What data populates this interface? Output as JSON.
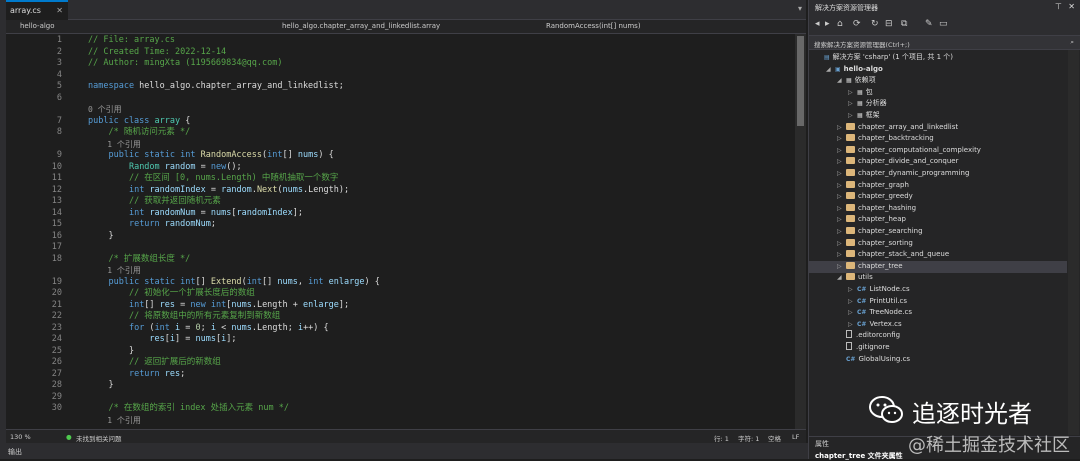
{
  "tabs": [
    {
      "label": "array.cs"
    }
  ],
  "nav": {
    "project": "hello-algo",
    "namespace": "hello_algo.chapter_array_and_linkedlist.array",
    "member": "RandomAccess(int[] nums)"
  },
  "code_lines": [
    {
      "n": "1",
      "parts": [
        [
          "c-com",
          "// File: array.cs"
        ]
      ]
    },
    {
      "n": "2",
      "parts": [
        [
          "c-com",
          "// Created Time: 2022-12-14"
        ]
      ]
    },
    {
      "n": "3",
      "parts": [
        [
          "c-com",
          "// Author: mingXta (1195669834@qq.com)"
        ]
      ]
    },
    {
      "n": "4",
      "parts": []
    },
    {
      "n": "5",
      "parts": [
        [
          "c-kw",
          "namespace"
        ],
        [
          "",
          " hello_algo.chapter_array_and_linkedlist;"
        ]
      ]
    },
    {
      "n": "6",
      "parts": []
    },
    {
      "lens": "0 个引用"
    },
    {
      "n": "7",
      "parts": [
        [
          "c-kw",
          "public class"
        ],
        [
          "",
          " "
        ],
        [
          "c-ty",
          "array"
        ],
        [
          "",
          " {"
        ]
      ]
    },
    {
      "n": "8",
      "parts": [
        [
          "",
          "    "
        ],
        [
          "c-com",
          "/* 随机访问元素 */"
        ]
      ]
    },
    {
      "lens": "    1 个引用"
    },
    {
      "n": "9",
      "parts": [
        [
          "",
          "    "
        ],
        [
          "c-kw",
          "public static int"
        ],
        [
          "",
          " "
        ],
        [
          "c-fn",
          "RandomAccess"
        ],
        [
          "",
          "("
        ],
        [
          "c-kw",
          "int"
        ],
        [
          "",
          "[] "
        ],
        [
          "c-var",
          "nums"
        ],
        [
          "",
          ") {"
        ]
      ]
    },
    {
      "n": "10",
      "parts": [
        [
          "",
          "        "
        ],
        [
          "c-ty",
          "Random"
        ],
        [
          "",
          " "
        ],
        [
          "c-var",
          "random"
        ],
        [
          "",
          " = "
        ],
        [
          "c-kw",
          "new"
        ],
        [
          "",
          "();"
        ]
      ]
    },
    {
      "n": "11",
      "parts": [
        [
          "",
          "        "
        ],
        [
          "c-com",
          "// 在区间 [0, nums.Length) 中随机抽取一个数字"
        ]
      ]
    },
    {
      "n": "12",
      "parts": [
        [
          "",
          "        "
        ],
        [
          "c-kw",
          "int"
        ],
        [
          "",
          " "
        ],
        [
          "c-var",
          "randomIndex"
        ],
        [
          "",
          " = "
        ],
        [
          "c-var",
          "random"
        ],
        [
          "",
          "."
        ],
        [
          "c-fn",
          "Next"
        ],
        [
          "",
          "("
        ],
        [
          "c-var",
          "nums"
        ],
        [
          "",
          ".Length);"
        ]
      ]
    },
    {
      "n": "13",
      "parts": [
        [
          "",
          "        "
        ],
        [
          "c-com",
          "// 获取并返回随机元素"
        ]
      ]
    },
    {
      "n": "14",
      "parts": [
        [
          "",
          "        "
        ],
        [
          "c-kw",
          "int"
        ],
        [
          "",
          " "
        ],
        [
          "c-var",
          "randomNum"
        ],
        [
          "",
          " = "
        ],
        [
          "c-var",
          "nums"
        ],
        [
          "",
          "["
        ],
        [
          "c-var",
          "randomIndex"
        ],
        [
          "",
          "];"
        ]
      ]
    },
    {
      "n": "15",
      "parts": [
        [
          "",
          "        "
        ],
        [
          "c-kw",
          "return"
        ],
        [
          "",
          " "
        ],
        [
          "c-var",
          "randomNum"
        ],
        [
          "",
          ";"
        ]
      ]
    },
    {
      "n": "16",
      "parts": [
        [
          "",
          "    }"
        ]
      ]
    },
    {
      "n": "17",
      "parts": []
    },
    {
      "n": "18",
      "parts": [
        [
          "",
          "    "
        ],
        [
          "c-com",
          "/* 扩展数组长度 */"
        ]
      ]
    },
    {
      "lens": "    1 个引用"
    },
    {
      "n": "19",
      "parts": [
        [
          "",
          "    "
        ],
        [
          "c-kw",
          "public static int"
        ],
        [
          "",
          "[] "
        ],
        [
          "c-fn",
          "Extend"
        ],
        [
          "",
          "("
        ],
        [
          "c-kw",
          "int"
        ],
        [
          "",
          "[] "
        ],
        [
          "c-var",
          "nums"
        ],
        [
          "",
          ", "
        ],
        [
          "c-kw",
          "int"
        ],
        [
          "",
          " "
        ],
        [
          "c-var",
          "enlarge"
        ],
        [
          "",
          ") {"
        ]
      ]
    },
    {
      "n": "20",
      "parts": [
        [
          "",
          "        "
        ],
        [
          "c-com",
          "// 初始化一个扩展长度后的数组"
        ]
      ]
    },
    {
      "n": "21",
      "parts": [
        [
          "",
          "        "
        ],
        [
          "c-kw",
          "int"
        ],
        [
          "",
          "[] "
        ],
        [
          "c-var",
          "res"
        ],
        [
          "",
          " = "
        ],
        [
          "c-kw",
          "new int"
        ],
        [
          "",
          "["
        ],
        [
          "c-var",
          "nums"
        ],
        [
          "",
          ".Length + "
        ],
        [
          "c-var",
          "enlarge"
        ],
        [
          "",
          "];"
        ]
      ]
    },
    {
      "n": "22",
      "parts": [
        [
          "",
          "        "
        ],
        [
          "c-com",
          "// 将原数组中的所有元素复制到新数组"
        ]
      ]
    },
    {
      "n": "23",
      "parts": [
        [
          "",
          "        "
        ],
        [
          "c-kw",
          "for"
        ],
        [
          "",
          " ("
        ],
        [
          "c-kw",
          "int"
        ],
        [
          "",
          " "
        ],
        [
          "c-var",
          "i"
        ],
        [
          "",
          " = "
        ],
        [
          "c-num",
          "0"
        ],
        [
          "",
          "; "
        ],
        [
          "c-var",
          "i"
        ],
        [
          "",
          " < "
        ],
        [
          "c-var",
          "nums"
        ],
        [
          "",
          ".Length; "
        ],
        [
          "c-var",
          "i"
        ],
        [
          "",
          "++) {"
        ]
      ]
    },
    {
      "n": "24",
      "parts": [
        [
          "",
          "            "
        ],
        [
          "c-var",
          "res"
        ],
        [
          "",
          "["
        ],
        [
          "c-var",
          "i"
        ],
        [
          "",
          "] = "
        ],
        [
          "c-var",
          "nums"
        ],
        [
          "",
          "["
        ],
        [
          "c-var",
          "i"
        ],
        [
          "",
          "];"
        ]
      ]
    },
    {
      "n": "25",
      "parts": [
        [
          "",
          "        }"
        ]
      ]
    },
    {
      "n": "26",
      "parts": [
        [
          "",
          "        "
        ],
        [
          "c-com",
          "// 返回扩展后的新数组"
        ]
      ]
    },
    {
      "n": "27",
      "parts": [
        [
          "",
          "        "
        ],
        [
          "c-kw",
          "return"
        ],
        [
          "",
          " "
        ],
        [
          "c-var",
          "res"
        ],
        [
          "",
          ";"
        ]
      ]
    },
    {
      "n": "28",
      "parts": [
        [
          "",
          "    }"
        ]
      ]
    },
    {
      "n": "29",
      "parts": []
    },
    {
      "n": "30",
      "parts": [
        [
          "",
          "    "
        ],
        [
          "c-com",
          "/* 在数组的索引 index 处插入元素 num */"
        ]
      ]
    },
    {
      "lens": "    1 个引用"
    }
  ],
  "status": {
    "zoom": "130 %",
    "issues": "未找到相关问题",
    "row": "行: 1",
    "col": "字符: 1",
    "ws": "空格",
    "eol": "LF"
  },
  "output_label": "输出",
  "solution_explorer": {
    "title": "解决方案资源管理器",
    "search_placeholder": "搜索解决方案资源管理器(Ctrl+;)",
    "items": [
      {
        "label": "解决方案 'csharp' (1 个项目, 共 1 个)",
        "indent": 0,
        "kind": "sln",
        "arrow": ""
      },
      {
        "label": "hello-algo",
        "indent": 1,
        "kind": "proj",
        "arrow": "◢"
      },
      {
        "label": "依赖项",
        "indent": 2,
        "kind": "dep",
        "arrow": "◢"
      },
      {
        "label": "包",
        "indent": 3,
        "kind": "dep",
        "arrow": "▷"
      },
      {
        "label": "分析器",
        "indent": 3,
        "kind": "dep",
        "arrow": "▷"
      },
      {
        "label": "框架",
        "indent": 3,
        "kind": "dep",
        "arrow": "▷"
      },
      {
        "label": "chapter_array_and_linkedlist",
        "indent": 2,
        "kind": "folder",
        "arrow": "▷"
      },
      {
        "label": "chapter_backtracking",
        "indent": 2,
        "kind": "folder",
        "arrow": "▷"
      },
      {
        "label": "chapter_computational_complexity",
        "indent": 2,
        "kind": "folder",
        "arrow": "▷"
      },
      {
        "label": "chapter_divide_and_conquer",
        "indent": 2,
        "kind": "folder",
        "arrow": "▷"
      },
      {
        "label": "chapter_dynamic_programming",
        "indent": 2,
        "kind": "folder",
        "arrow": "▷"
      },
      {
        "label": "chapter_graph",
        "indent": 2,
        "kind": "folder",
        "arrow": "▷"
      },
      {
        "label": "chapter_greedy",
        "indent": 2,
        "kind": "folder",
        "arrow": "▷"
      },
      {
        "label": "chapter_hashing",
        "indent": 2,
        "kind": "folder",
        "arrow": "▷"
      },
      {
        "label": "chapter_heap",
        "indent": 2,
        "kind": "folder",
        "arrow": "▷"
      },
      {
        "label": "chapter_searching",
        "indent": 2,
        "kind": "folder",
        "arrow": "▷"
      },
      {
        "label": "chapter_sorting",
        "indent": 2,
        "kind": "folder",
        "arrow": "▷"
      },
      {
        "label": "chapter_stack_and_queue",
        "indent": 2,
        "kind": "folder",
        "arrow": "▷"
      },
      {
        "label": "chapter_tree",
        "indent": 2,
        "kind": "folder",
        "arrow": "▷",
        "selected": true
      },
      {
        "label": "utils",
        "indent": 2,
        "kind": "folder",
        "arrow": "◢"
      },
      {
        "label": "ListNode.cs",
        "indent": 3,
        "kind": "cs",
        "arrow": "▷"
      },
      {
        "label": "PrintUtil.cs",
        "indent": 3,
        "kind": "cs",
        "arrow": "▷"
      },
      {
        "label": "TreeNode.cs",
        "indent": 3,
        "kind": "cs",
        "arrow": "▷"
      },
      {
        "label": "Vertex.cs",
        "indent": 3,
        "kind": "cs",
        "arrow": "▷"
      },
      {
        "label": ".editorconfig",
        "indent": 2,
        "kind": "file",
        "arrow": ""
      },
      {
        "label": ".gitignore",
        "indent": 2,
        "kind": "file",
        "arrow": ""
      },
      {
        "label": "GlobalUsing.cs",
        "indent": 2,
        "kind": "cs",
        "arrow": ""
      }
    ]
  },
  "properties": {
    "title": "属性",
    "subject": "chapter_tree  文件夹属性"
  },
  "watermark": {
    "line1": "追逐时光者",
    "line2": "@稀土掘金技术社区"
  }
}
